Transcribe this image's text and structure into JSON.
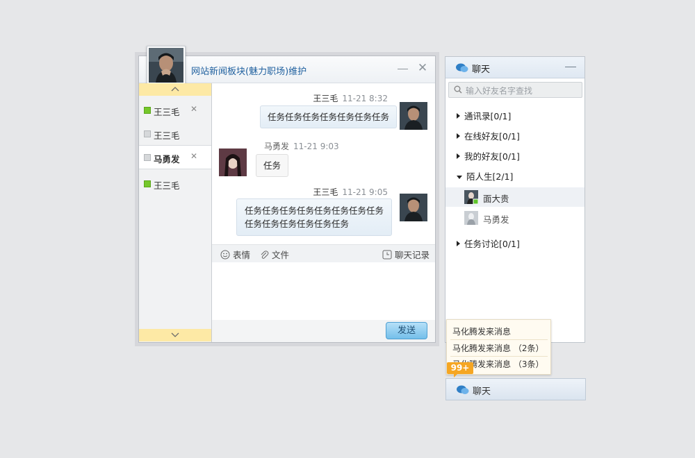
{
  "chat_window": {
    "title": "网站新闻板块(魅力职场)维护",
    "contacts": [
      {
        "name": "王三毛",
        "status": "online",
        "closable": true
      },
      {
        "name": "王三毛",
        "status": "offline",
        "closable": false
      },
      {
        "name": "马勇发",
        "status": "offline",
        "closable": true,
        "active": true
      },
      {
        "name": "王三毛",
        "status": "online",
        "closable": false
      }
    ],
    "messages": [
      {
        "sender": "王三毛",
        "time": "11-21 8:32",
        "text": "任务任务任务任务任务任务任务",
        "side": "right"
      },
      {
        "sender": "马勇发",
        "time": "11-21 9:03",
        "text": "任务",
        "side": "left"
      },
      {
        "sender": "王三毛",
        "time": "11-21 9:05",
        "text_line1": "任务任务任务任务任务任务任务任务",
        "text_line2": "任务任务任务任务任务任务",
        "side": "right"
      }
    ],
    "toolbar": {
      "emoji": "表情",
      "file": "文件",
      "history": "聊天记录"
    },
    "send_label": "发送"
  },
  "buddy_panel": {
    "title": "聊天",
    "search_placeholder": "输入好友名字查找",
    "groups": [
      {
        "label": "通讯录[0/1]",
        "expanded": false
      },
      {
        "label": "在线好友[0/1]",
        "expanded": false
      },
      {
        "label": "我的好友[0/1]",
        "expanded": false
      },
      {
        "label": "陌人生[2/1]",
        "expanded": true
      },
      {
        "label": "任务讨论[0/1]",
        "expanded": false
      }
    ],
    "friends": [
      {
        "name": "面大贵",
        "online": true
      },
      {
        "name": "马勇发",
        "online": false
      }
    ]
  },
  "notifications": {
    "items": [
      "马化腾发来消息",
      "马化腾发来消息 （2条）",
      "马化腾发来消息 （3条）"
    ],
    "badge": "99+"
  },
  "taskbar": {
    "label": "聊天"
  },
  "colors": {
    "online": "#76c72b",
    "accent": "#1e5f9e",
    "badge": "#f5a623",
    "scroll": "#fde9a5"
  }
}
